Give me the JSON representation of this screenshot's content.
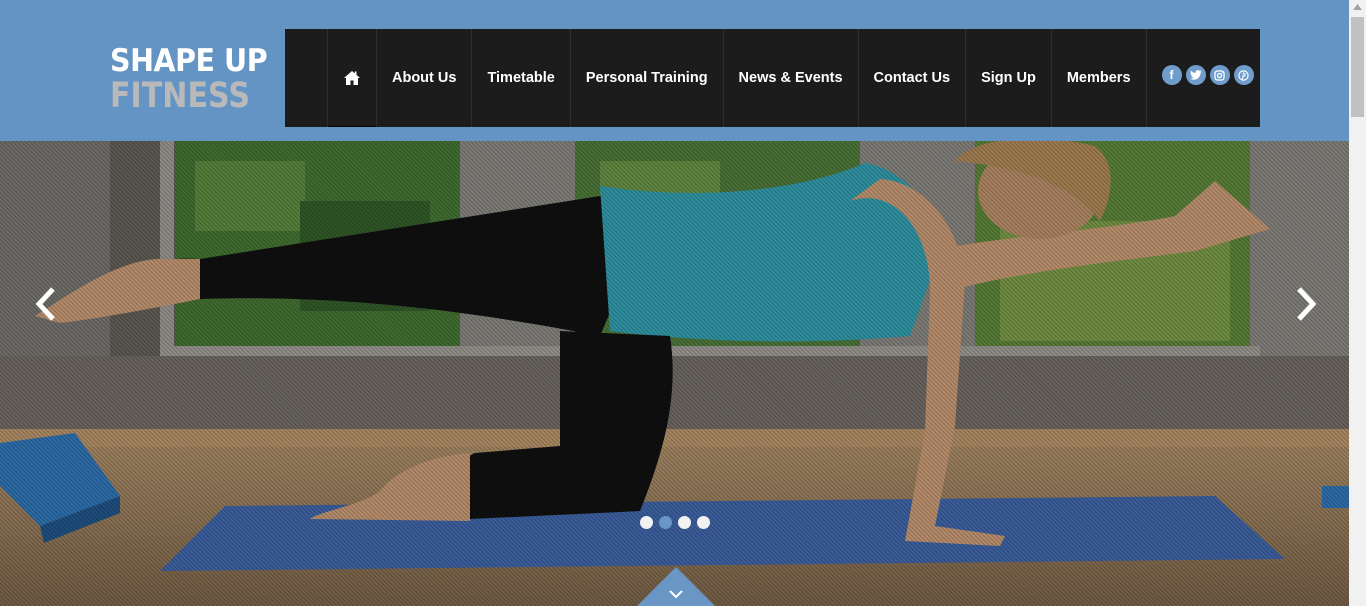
{
  "logo": {
    "line1": "SHAPE UP",
    "line2": "FITNESS"
  },
  "nav": {
    "home_icon": "home-icon",
    "items": [
      {
        "label": "About Us"
      },
      {
        "label": "Timetable"
      },
      {
        "label": "Personal Training"
      },
      {
        "label": "News & Events"
      },
      {
        "label": "Contact Us"
      },
      {
        "label": "Sign Up"
      },
      {
        "label": "Members"
      }
    ]
  },
  "social": [
    {
      "icon": "facebook-icon",
      "glyph": "f"
    },
    {
      "icon": "twitter-icon"
    },
    {
      "icon": "instagram-icon"
    },
    {
      "icon": "pinterest-icon"
    }
  ],
  "slider": {
    "slide_count": 4,
    "active_slide": 2,
    "prev_icon": "chevron-left-icon",
    "next_icon": "chevron-right-icon",
    "scroll_icon": "chevron-down-icon"
  },
  "colors": {
    "header_bg": "#6494c4",
    "nav_bg": "#1c1c1c",
    "logo_primary": "#ffffff",
    "logo_secondary": "#b9b9b9",
    "accent": "#6a96c6"
  }
}
